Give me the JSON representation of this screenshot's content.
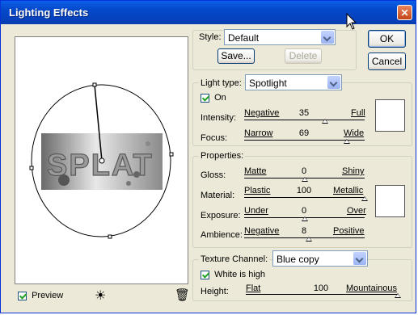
{
  "window": {
    "title": "Lighting Effects"
  },
  "preview": {
    "text": "SPLAT",
    "checkbox_label": "Preview"
  },
  "style_row": {
    "label": "Style:",
    "value": "Default",
    "save_label": "Save...",
    "delete_label": "Delete"
  },
  "buttons": {
    "ok": "OK",
    "cancel": "Cancel"
  },
  "light_type": {
    "label": "Light type:",
    "value": "Spotlight",
    "on_label": "On",
    "intensity": {
      "label": "Intensity:",
      "min": "Negative",
      "value": "35",
      "max": "Full",
      "level": 0.67
    },
    "focus": {
      "label": "Focus:",
      "min": "Narrow",
      "value": "69",
      "max": "Wide",
      "level": 0.85
    }
  },
  "properties": {
    "label": "Properties:",
    "gloss": {
      "label": "Gloss:",
      "min": "Matte",
      "value": "0",
      "max": "Shiny",
      "level": 0.5
    },
    "material": {
      "label": "Material:",
      "min": "Plastic",
      "value": "100",
      "max": "Metallic",
      "level": 1.0
    },
    "exposure": {
      "label": "Exposure:",
      "min": "Under",
      "value": "0",
      "max": "Over",
      "level": 0.5
    },
    "ambience": {
      "label": "Ambience:",
      "min": "Negative",
      "value": "8",
      "max": "Positive",
      "level": 0.54
    }
  },
  "texture": {
    "label": "Texture Channel:",
    "value": "Blue copy",
    "white_high_label": "White is high",
    "height": {
      "label": "Height:",
      "min": "Flat",
      "value": "100",
      "max": "Mountainous",
      "level": 1.0
    }
  }
}
